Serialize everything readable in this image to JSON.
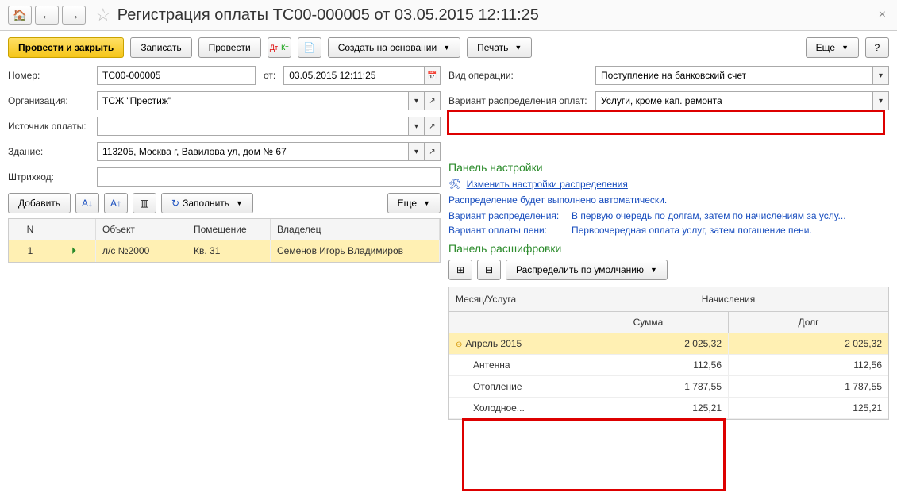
{
  "title": "Регистрация оплаты ТС00-000005 от 03.05.2015 12:11:25",
  "toolbar": {
    "commit_close": "Провести и закрыть",
    "save": "Записать",
    "commit": "Провести",
    "create_based": "Создать на основании",
    "print": "Печать",
    "more": "Еще",
    "more2": "Еще",
    "add": "Добавить",
    "fill": "Заполнить"
  },
  "form": {
    "number_label": "Номер:",
    "number": "ТС00-000005",
    "from_label": "от:",
    "date": "03.05.2015 12:11:25",
    "org_label": "Организация:",
    "org": "ТСЖ \"Престиж\"",
    "source_label": "Источник оплаты:",
    "source": "",
    "building_label": "Здание:",
    "building": "113205, Москва г, Вавилова ул, дом № 67",
    "barcode_label": "Штрихкод:",
    "barcode": "",
    "optype_label": "Вид операции:",
    "optype": "Поступление на банковский счет",
    "variant_label": "Вариант распределения оплат:",
    "variant": "Услуги, кроме кап. ремонта"
  },
  "grid": {
    "headers": {
      "n": "N",
      "obj": "Объект",
      "room": "Помещение",
      "owner": "Владелец"
    },
    "row": {
      "n": "1",
      "obj": "л/с №2000",
      "room": "Кв. 31",
      "owner": "Семенов Игорь Владимиров"
    }
  },
  "settings": {
    "panel_title": "Панель настройки",
    "change_link": "Изменить настройки распределения",
    "auto_text": "Распределение будет выполнено автоматически.",
    "variant_label": "Вариант распределения:",
    "variant_val": "В первую очередь по долгам, затем по начислениям за услу...",
    "peni_label": "Вариант оплаты пени:",
    "peni_val": "Первоочередная оплата услуг, затем погашение пени."
  },
  "detail": {
    "panel_title": "Панель расшифровки",
    "distribute": "Распределить по умолчанию",
    "headers": {
      "month": "Месяц/Услуга",
      "charges": "Начисления",
      "sum": "Сумма",
      "debt": "Долг"
    },
    "rows": [
      {
        "label": "Апрель 2015",
        "sum": "2 025,32",
        "debt": "2 025,32",
        "group": true
      },
      {
        "label": "Антенна",
        "sum": "112,56",
        "debt": "112,56"
      },
      {
        "label": "Отопление",
        "sum": "1 787,55",
        "debt": "1 787,55"
      },
      {
        "label": "Холодное...",
        "sum": "125,21",
        "debt": "125,21"
      }
    ]
  }
}
